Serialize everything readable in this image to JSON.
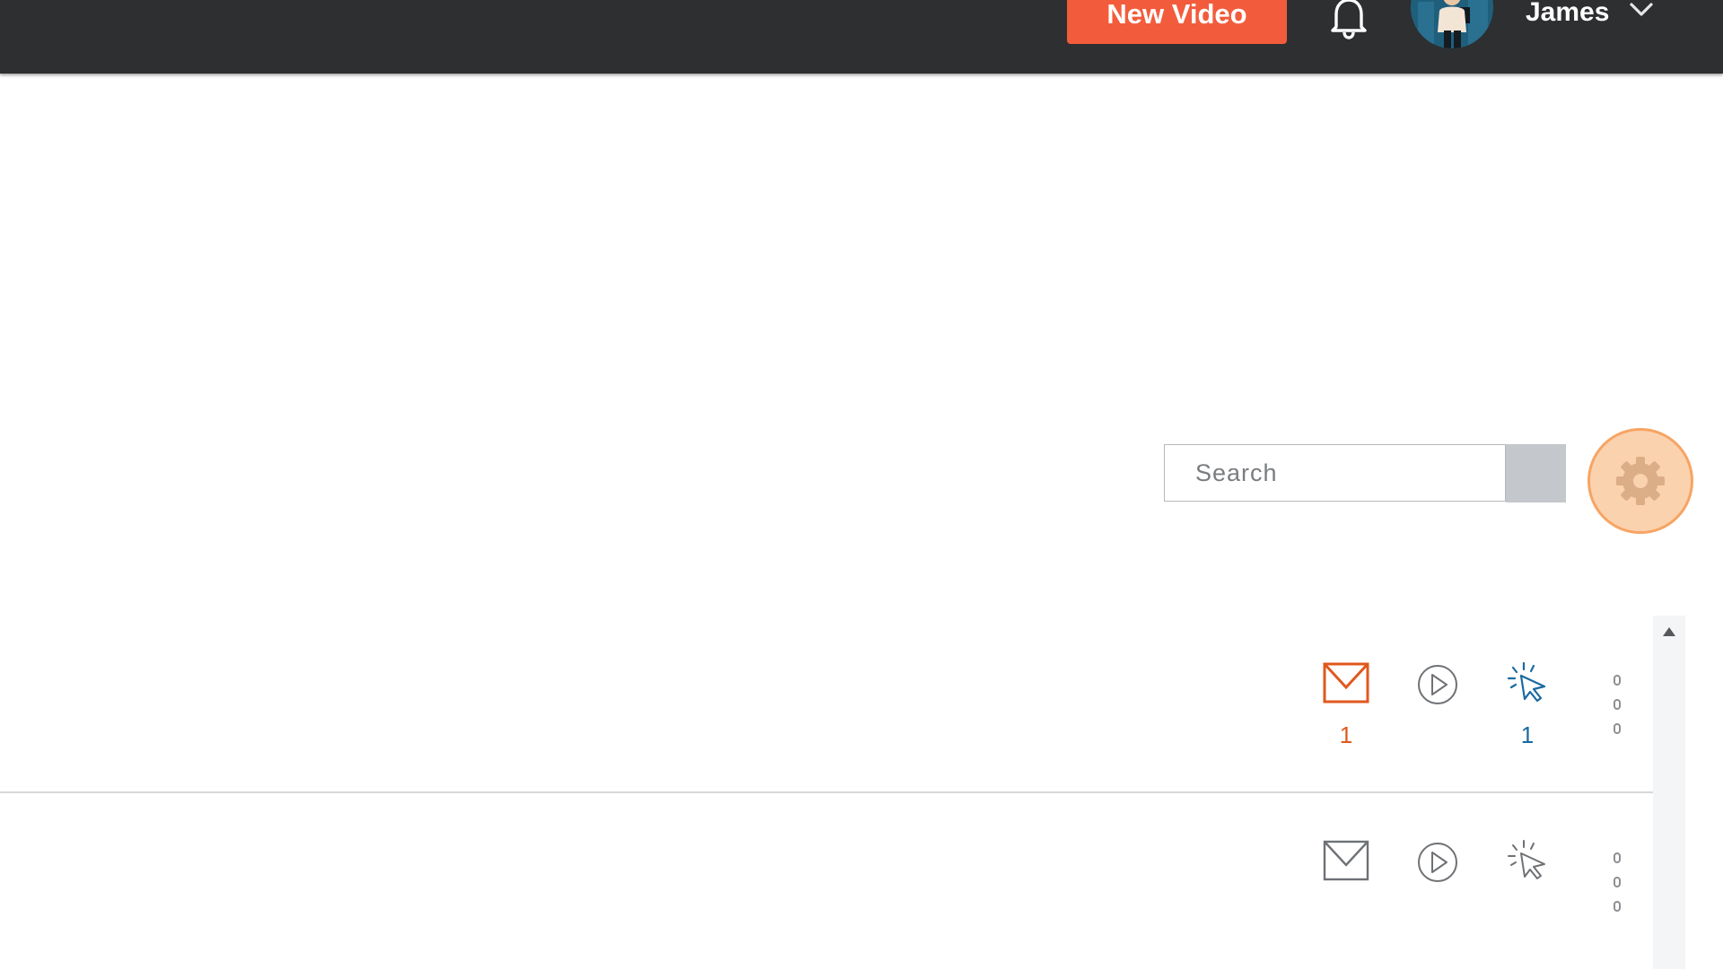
{
  "header": {
    "new_video_label": "New Video",
    "user_name": "James",
    "icons": {
      "bell": "bell-icon",
      "avatar": "avatar",
      "menu": "chevron-down-icon"
    }
  },
  "search": {
    "placeholder": "Search",
    "value": ""
  },
  "settings": {
    "icon": "gear-icon"
  },
  "rows": [
    {
      "email_count": "1",
      "play_count": "",
      "click_count": "1",
      "email_color": "#e0581e",
      "click_color": "#1a6aa0"
    },
    {
      "email_count": "",
      "play_count": "",
      "click_count": "",
      "email_color": "#6e7175",
      "click_color": "#6e7175"
    }
  ],
  "colors": {
    "header_bg": "#2e2f31",
    "primary": "#f25c3c",
    "settings_bg": "#fbd2ae",
    "settings_border": "#f7a463"
  }
}
